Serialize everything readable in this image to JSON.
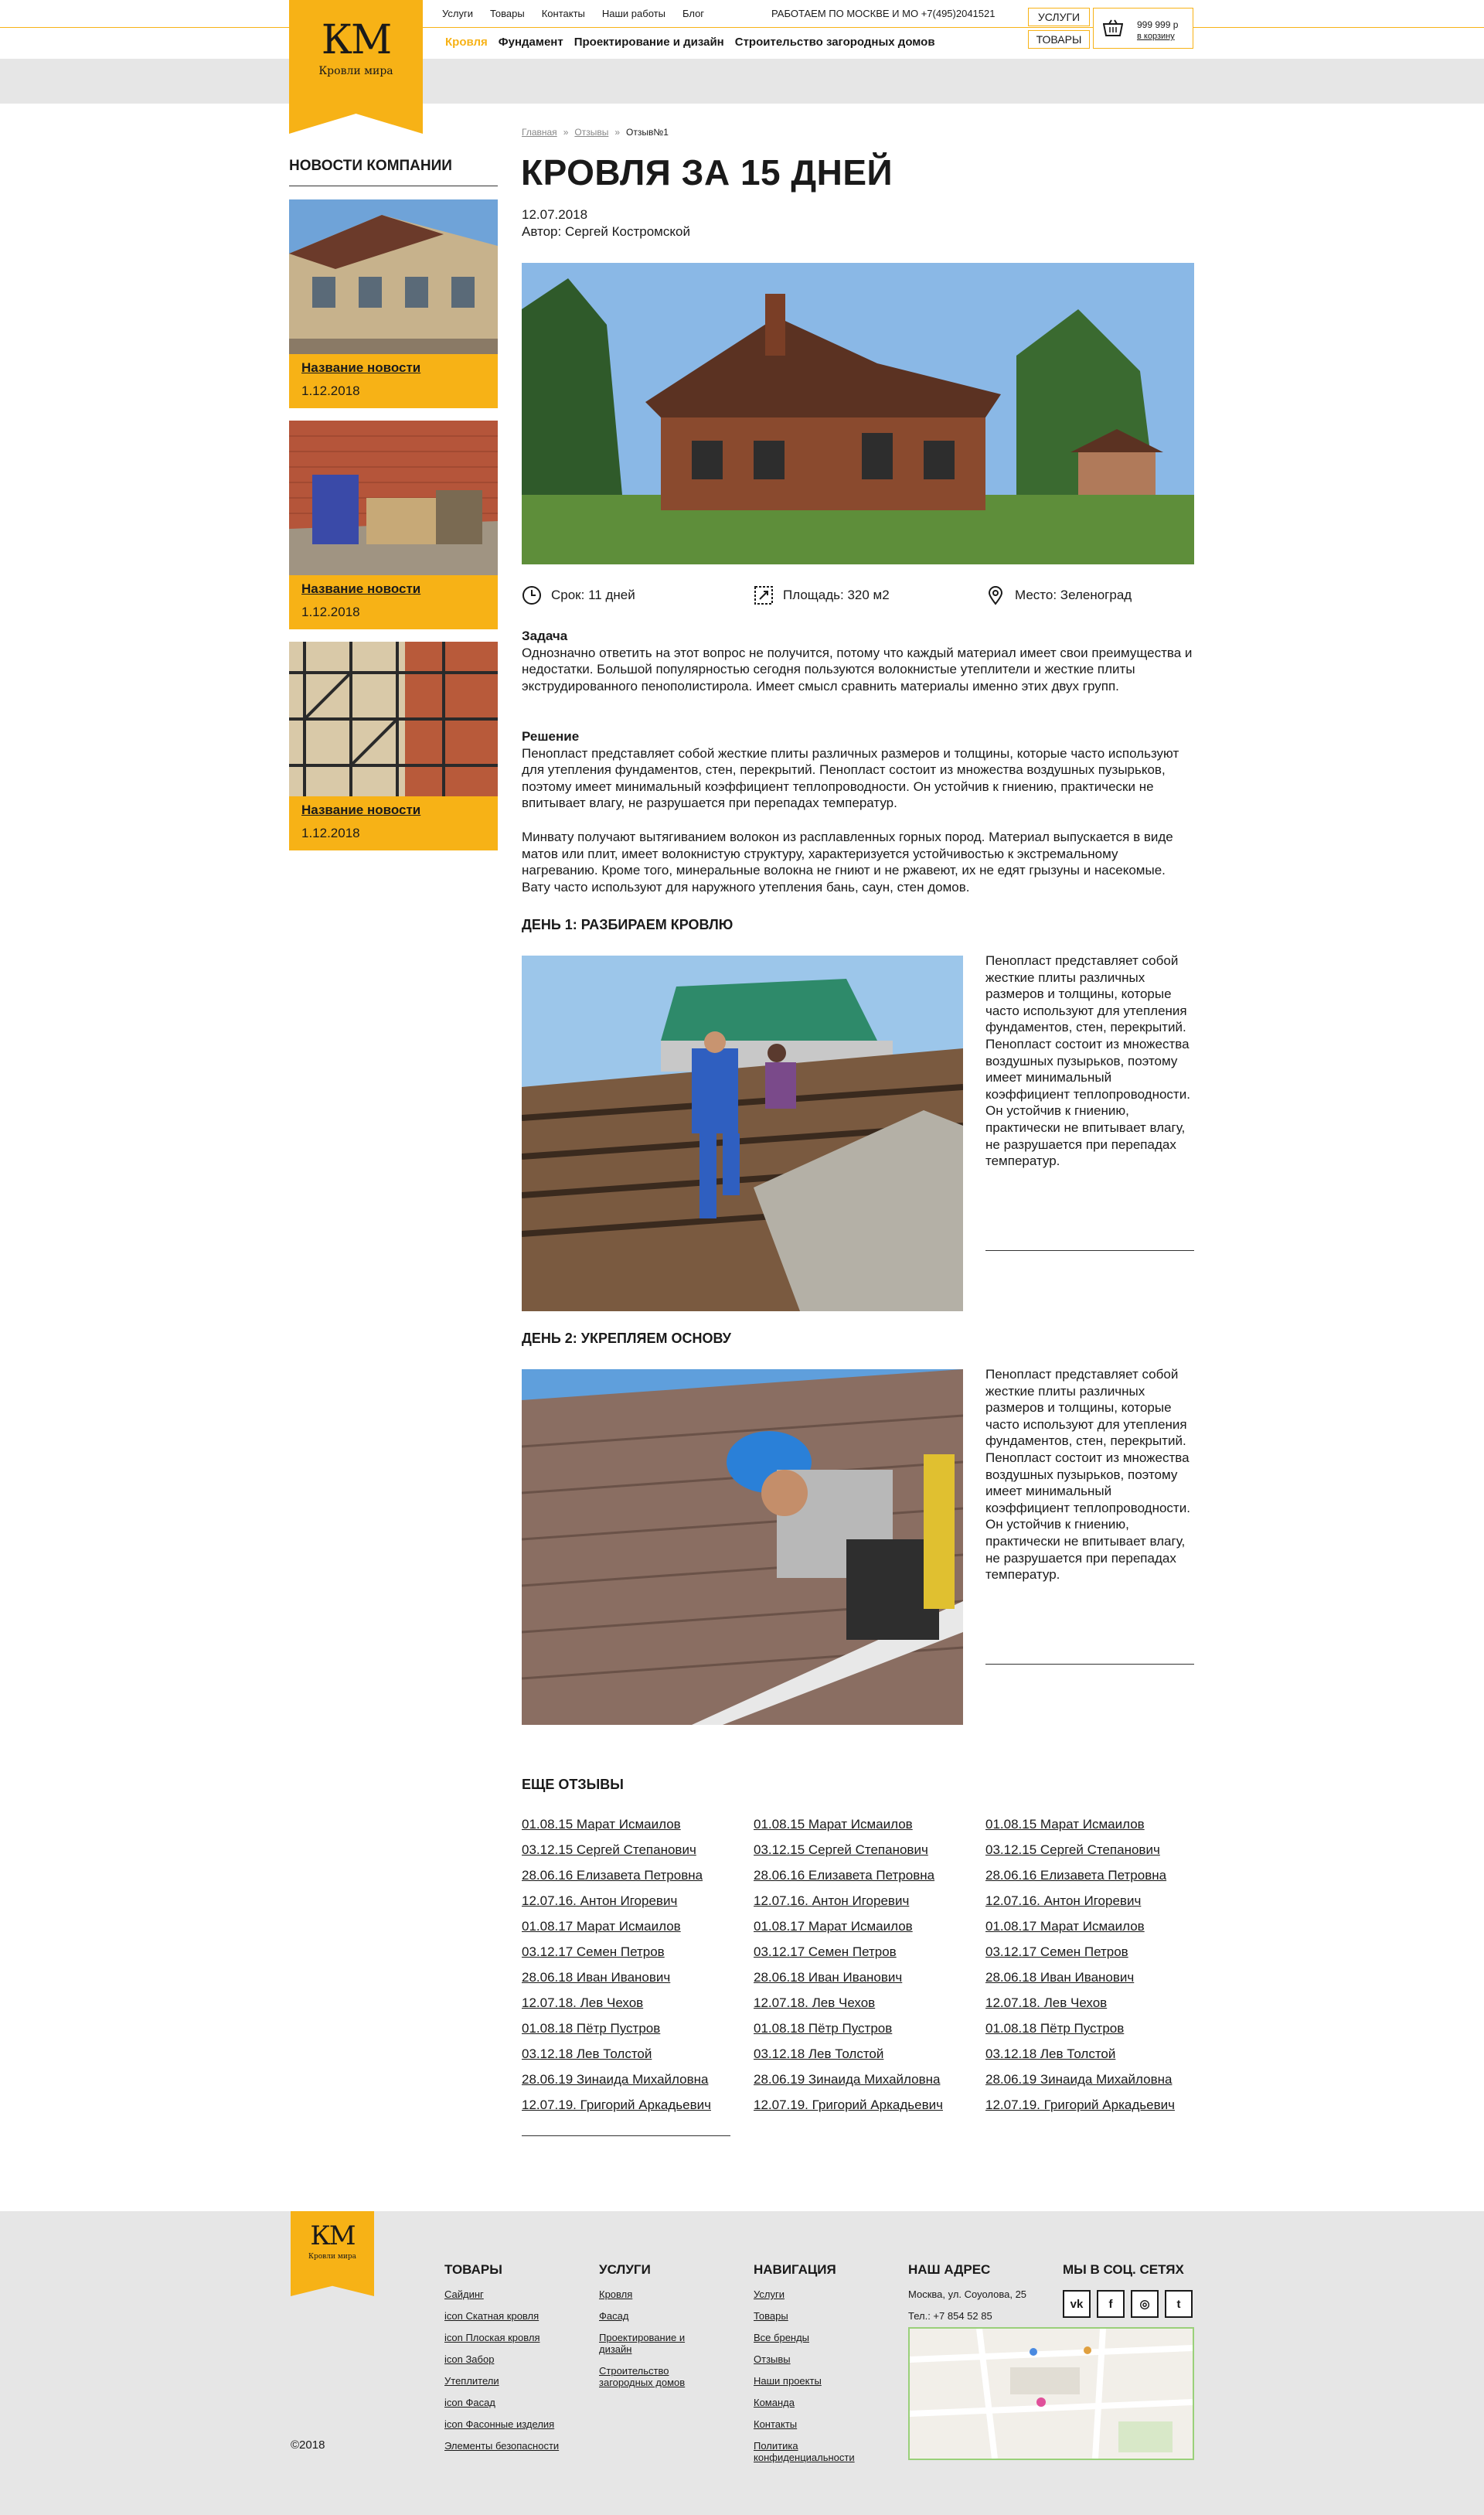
{
  "brand": {
    "monogram": "КМ",
    "name": "Кровли мира"
  },
  "topnav": [
    "Услуги",
    "Товары",
    "Контакты",
    "Наши работы",
    "Блог"
  ],
  "phone": "РАБОТАЕМ ПО МОСКВЕ И МО +7(495)2041521",
  "mainnav": [
    "Кровля",
    "Фундамент",
    "Проектирование и дизайн",
    "Строительство загородных домов"
  ],
  "header_buttons": {
    "services": "УСЛУГИ",
    "goods": "ТОВАРЫ"
  },
  "cart": {
    "price": "999 999 р",
    "link": "в корзину"
  },
  "sidebar": {
    "title": "НОВОСТИ КОМПАНИИ",
    "news": [
      {
        "title": "Название новости",
        "date": "1.12.2018"
      },
      {
        "title": "Название новости",
        "date": "1.12.2018"
      },
      {
        "title": "Название новости",
        "date": "1.12.2018"
      }
    ]
  },
  "breadcrumbs": {
    "items": [
      "Главная",
      "Отзывы"
    ],
    "current": "Отзыв№1",
    "sep": "»"
  },
  "article": {
    "title": "КРОВЛЯ ЗА 15 ДНЕЙ",
    "date": "12.07.2018",
    "author": "Автор: Сергей Костромской",
    "facts": {
      "term": "Срок: 11 дней",
      "area": "Площадь: 320 м2",
      "place": "Место: Зеленоград"
    },
    "task_label": "Задача",
    "task_text": "Однозначно ответить на этот вопрос не получится, потому что каждый материал имеет свои преимущества и недостатки. Большой популярностью сегодня пользуются волокнистые утеплители и жесткие плиты экструдированного пенополистирола. Имеет смысл сравнить материалы именно этих двух групп.",
    "solution_label": "Решение",
    "solution_text": "Пенопласт представляет собой жесткие плиты различных размеров и толщины, которые часто используют для утепления фундаментов, стен, перекрытий. Пенопласт состоит из множества воздушных пузырьков, поэтому имеет минимальный коэффициент теплопроводности. Он устойчив к гниению, практически не впитывает влагу, не разрушается при перепадах температур.",
    "solution_text2": "Минвату получают вытягиванием волокон из расплавленных горных пород. Материал выпускается в виде матов или плит, имеет волокнистую структуру, характеризуется устойчивостью к экстремальному нагреванию. Кроме того, минеральные волокна не гниют и не ржавеют, их не едят грызуны и насекомые. Вату часто используют для наружного утепления бань, саун, стен домов.",
    "day1_title": "ДЕНЬ 1: РАЗБИРАЕМ КРОВЛЮ",
    "day1_text": "Пенопласт представляет собой жесткие плиты различных размеров и толщины, которые часто используют для утепления фундаментов, стен, перекрытий. Пенопласт состоит из множества воздушных пузырьков, поэтому имеет минимальный коэффициент теплопроводности. Он устойчив к гниению, практически не впитывает влагу, не разрушается при перепадах температур.",
    "day2_title": "ДЕНЬ 2: УКРЕПЛЯЕМ ОСНОВУ",
    "day2_text": "Пенопласт представляет собой жесткие плиты различных размеров и толщины, которые часто используют для утепления фундаментов, стен, перекрытий. Пенопласт состоит из множества воздушных пузырьков, поэтому имеет минимальный коэффициент теплопроводности. Он устойчив к гниению, практически не впитывает влагу, не разрушается при перепадах температур."
  },
  "more_reviews": {
    "title": "ЕЩЕ ОТЗЫВЫ",
    "columns": [
      [
        "01.08.15 Марат Исмаилов",
        "03.12.15 Сергей Степанович",
        "28.06.16 Елизавета Петровна",
        "12.07.16. Антон Игоревич",
        "01.08.17 Марат Исмаилов",
        "03.12.17 Семен Петров",
        "28.06.18 Иван Иванович",
        "12.07.18. Лев Чехов",
        "01.08.18 Пётр Пустров",
        "03.12.18 Лев Толстой",
        "28.06.19 Зинаида Михайловна",
        "12.07.19. Григорий Аркадьевич"
      ],
      [
        "01.08.15 Марат Исмаилов",
        "03.12.15 Сергей Степанович",
        "28.06.16 Елизавета Петровна",
        "12.07.16. Антон Игоревич",
        "01.08.17 Марат Исмаилов",
        "03.12.17 Семен Петров",
        "28.06.18 Иван Иванович",
        "12.07.18. Лев Чехов",
        "01.08.18 Пётр Пустров",
        "03.12.18 Лев Толстой",
        "28.06.19 Зинаида Михайловна",
        "12.07.19. Григорий Аркадьевич"
      ],
      [
        "01.08.15 Марат Исмаилов",
        "03.12.15 Сергей Степанович",
        "28.06.16 Елизавета Петровна",
        "12.07.16. Антон Игоревич",
        "01.08.17 Марат Исмаилов",
        "03.12.17 Семен Петров",
        "28.06.18 Иван Иванович",
        "12.07.18. Лев Чехов",
        "01.08.18 Пётр Пустров",
        "03.12.18 Лев Толстой",
        "28.06.19 Зинаида Михайловна",
        "12.07.19. Григорий Аркадьевич"
      ]
    ]
  },
  "footer": {
    "goods": {
      "title": "ТОВАРЫ",
      "links": [
        "Сайдинг",
        "icon Скатная кровля",
        "icon Плоская кровля",
        "icon Забор",
        "Утеплители",
        "icon Фасад",
        "icon Фасонные изделия",
        "Элементы безопасности"
      ]
    },
    "services": {
      "title": "УСЛУГИ",
      "links": [
        "Кровля",
        "Фасад",
        "Проектирование и дизайн",
        "Строительство загородных домов"
      ]
    },
    "navigation": {
      "title": "НАВИГАЦИЯ",
      "links": [
        "Услуги",
        "Товары",
        "Все бренды",
        "Отзывы",
        "Наши проекты",
        "Команда",
        "Контакты",
        "Политика конфиденциальности"
      ]
    },
    "address": {
      "title": "НАШ АДРЕС",
      "street": "Москва, ул. Соуолова, 25",
      "phone": "Тел.: +7 854 52 85"
    },
    "social": {
      "title": "МЫ В СОЦ. СЕТЯХ",
      "icons": [
        "vk-icon",
        "facebook-icon",
        "instagram-icon",
        "twitter-icon"
      ],
      "labels": [
        "vk",
        "f",
        "◎",
        "t"
      ]
    },
    "copyright": "©2018"
  },
  "colors": {
    "accent": "#F7B216",
    "gray": "#E6E6E6",
    "text": "#1a1a1a"
  }
}
